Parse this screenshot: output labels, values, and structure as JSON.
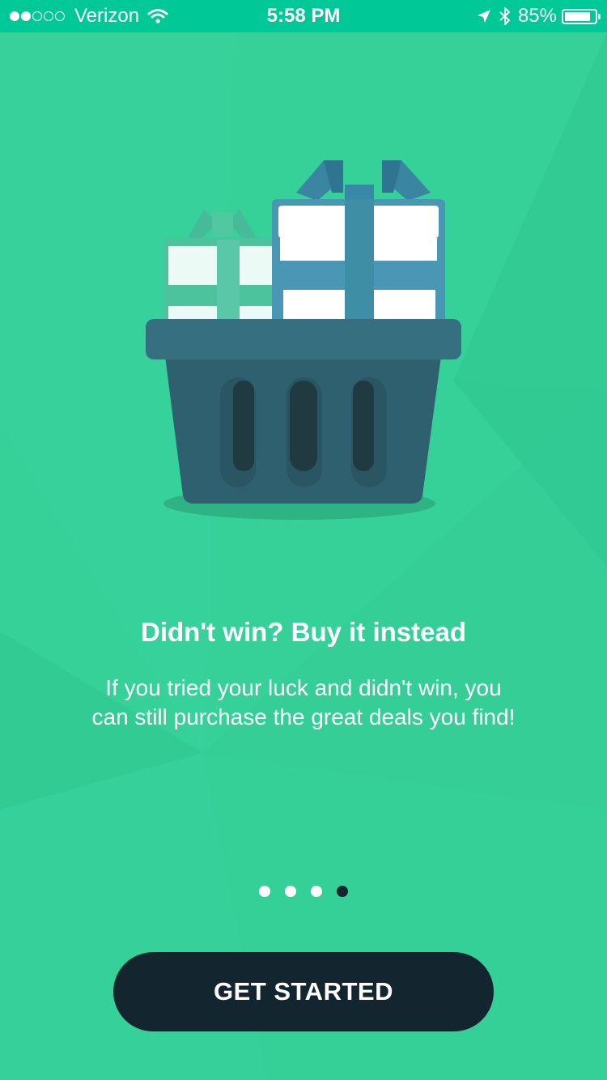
{
  "status_bar": {
    "carrier": "Verizon",
    "time": "5:58 PM",
    "battery_percent": "85%",
    "battery_level": 0.85,
    "signal_bars_filled": 2,
    "signal_bars_total": 5,
    "icons": [
      "wifi-icon",
      "location-arrow-icon",
      "bluetooth-icon",
      "battery-icon"
    ]
  },
  "illustration": {
    "name": "gift-basket"
  },
  "onboarding": {
    "title": "Didn't win? Buy it instead",
    "description_line1": "If you tried your luck and didn't win, you",
    "description_line2": "can still purchase the great deals you find!"
  },
  "pager": {
    "total": 4,
    "active_index": 3
  },
  "cta": {
    "label": "GET STARTED"
  },
  "colors": {
    "background": "#36d199",
    "status_bar": "#00c896",
    "button": "#13262f",
    "basket": "#2f6070",
    "gift_blue": "#3e8fa6",
    "gift_green": "#4cc49a"
  }
}
